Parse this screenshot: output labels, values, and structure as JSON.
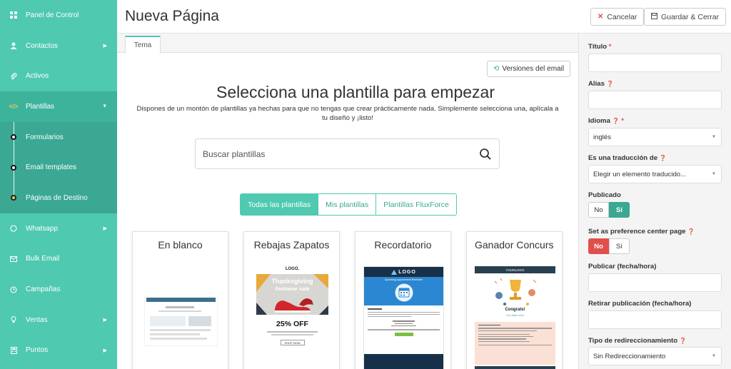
{
  "sidebar": {
    "items": [
      {
        "label": "Panel de Control",
        "icon": "dashboard-icon"
      },
      {
        "label": "Contactos",
        "icon": "user-icon"
      },
      {
        "label": "Activos",
        "icon": "paperclip-icon"
      },
      {
        "label": "Plantillas",
        "icon": "code-icon"
      },
      {
        "label": "Whatsapp",
        "icon": "whatsapp-icon"
      },
      {
        "label": "Bulk Email",
        "icon": "envelope-icon"
      },
      {
        "label": "Campañas",
        "icon": "clock-icon"
      },
      {
        "label": "Ventas",
        "icon": "lightbulb-icon"
      },
      {
        "label": "Puntos",
        "icon": "calculator-icon"
      }
    ],
    "sub_items": [
      {
        "label": "Formularios"
      },
      {
        "label": "Email templates"
      },
      {
        "label": "Páginas de Destino"
      }
    ]
  },
  "header": {
    "title": "Nueva Página",
    "cancel_label": "Cancelar",
    "save_close_label": "Guardar & Cerrar"
  },
  "main": {
    "tab_label": "Tema",
    "versions_label": "Versiones del email",
    "hero_title": "Selecciona una plantilla para empezar",
    "hero_subtitle": "Dispones de un montón de plantillas ya hechas para que no tengas que crear prácticamente nada. Simplemente selecciona una, aplícala a tu diseño y ¡listo!",
    "search_placeholder": "Buscar plantillas",
    "filters": [
      "Todas las plantillas",
      "Mis plantillas",
      "Plantillas FluxForce"
    ],
    "cards": [
      {
        "title": "En blanco"
      },
      {
        "title": "Rebajas Zapatos",
        "thumb_logo": "LOGO.",
        "thumb_head1": "Thanksgiving",
        "thumb_head2": "footwear sale",
        "thumb_offer": "25% OFF",
        "thumb_shop": "SHOP NOW"
      },
      {
        "title": "Recordatorio",
        "thumb_logo": "LOGO",
        "thumb_subtitle": "Upcoming Appointment Reminder"
      },
      {
        "title": "Ganador Concurs",
        "thumb_logo": "YOURLOGO",
        "thumb_congrats": "Congrats!",
        "thumb_won": "You have won"
      }
    ]
  },
  "right_panel": {
    "title_label": "Título",
    "alias_label": "Alias",
    "language_label": "Idioma",
    "language_value": "inglés",
    "translation_label": "Es una traducción de",
    "translation_value": "Elegir un elemento traducido...",
    "published_label": "Publicado",
    "published_no": "No",
    "published_yes": "Sí",
    "pref_center_label": "Set as preference center page",
    "pref_no": "No",
    "pref_yes": "Sí",
    "publish_date_label": "Publicar (fecha/hora)",
    "unpublish_date_label": "Retirar publicación (fecha/hora)",
    "redirect_type_label": "Tipo de redireccionamiento",
    "redirect_type_value": "Sin Redireccionamiento",
    "required_mark": "*"
  },
  "colors": {
    "sidebar": "#4fc9b0",
    "sidebar_active": "#3db39b",
    "accent": "#3aa892",
    "danger": "#e0504a"
  }
}
